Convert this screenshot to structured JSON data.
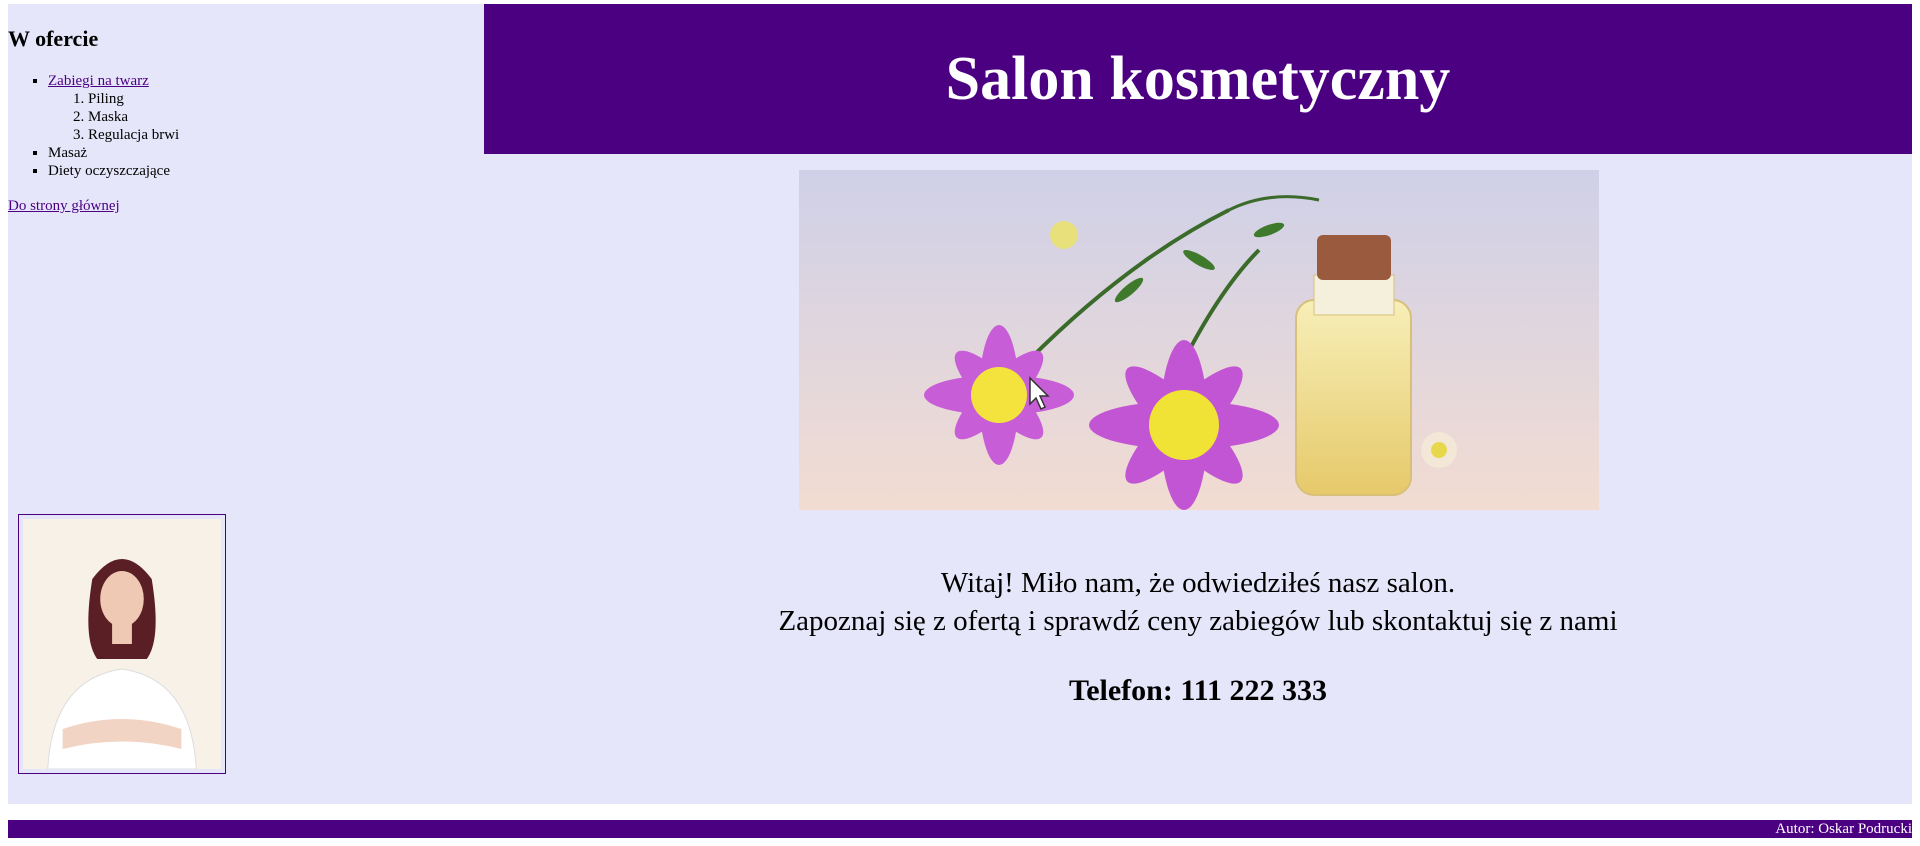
{
  "sidebar": {
    "heading": "W ofercie",
    "items": [
      {
        "label": "Zabiegi na twarz",
        "link": true,
        "sub": [
          "Piling",
          "Maska",
          "Regulacja brwi"
        ]
      },
      {
        "label": "Masaż",
        "link": false
      },
      {
        "label": "Diety oczyszczające",
        "link": false
      }
    ],
    "home_link": "Do strony głównej"
  },
  "header": {
    "title": "Salon kosmetyczny"
  },
  "main": {
    "welcome_line1": "Witaj! Miło nam, że odwiedziłeś nasz salon.",
    "welcome_line2": "Zapoznaj się z ofertą i sprawdź ceny zabiegów lub skontaktuj się z nami",
    "phone": "Telefon: 111 222 333"
  },
  "footer": {
    "author": "Autor: Oskar Podrucki"
  },
  "colors": {
    "accent": "#4b0082",
    "background": "#e6e6fa"
  }
}
